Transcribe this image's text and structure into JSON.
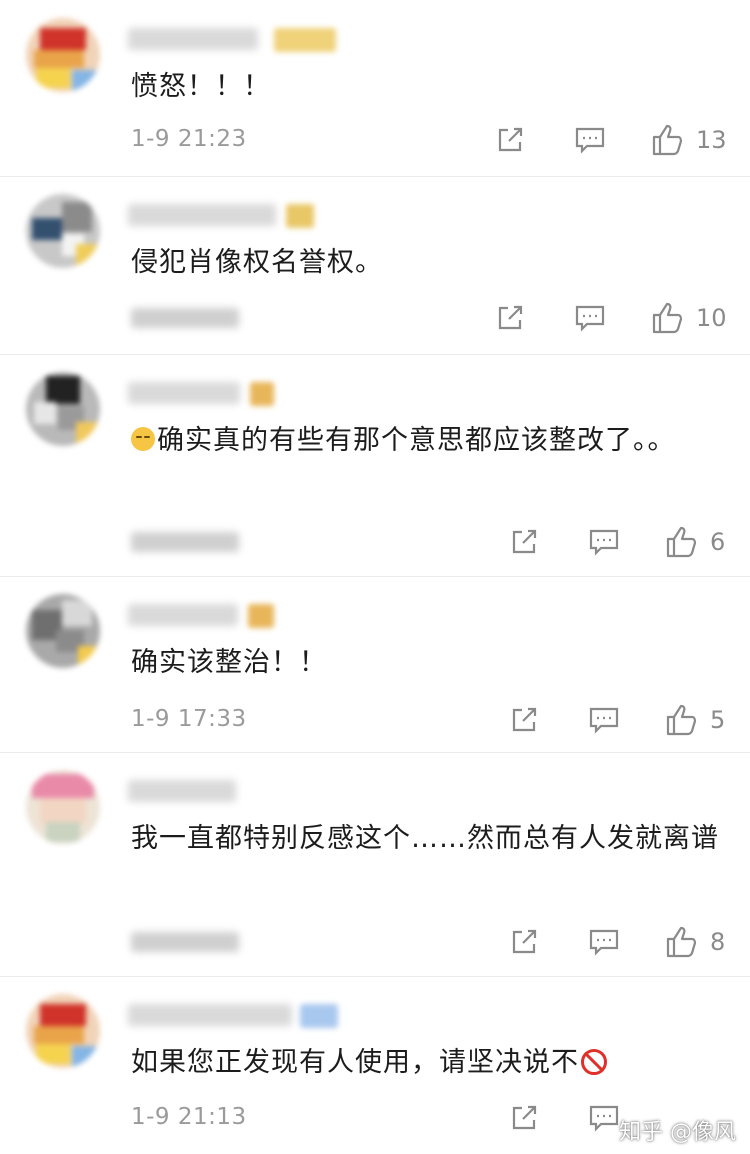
{
  "comments": [
    {
      "text": "愤怒！！！",
      "time": "1-9 21:23",
      "likes": "13",
      "time_blurred": false
    },
    {
      "text": "侵犯肖像权名誉权。",
      "time": "",
      "likes": "10",
      "time_blurred": true
    },
    {
      "text": "确实真的有些有那个意思都应该整改了。。",
      "time": "",
      "likes": "6",
      "time_blurred": true,
      "emoji": "pensive-emoji"
    },
    {
      "text": "确实该整治！！",
      "time": "1-9 17:33",
      "likes": "5",
      "time_blurred": false
    },
    {
      "text": "我一直都特别反感这个……然而总有人发就离谱",
      "time": "",
      "likes": "8",
      "time_blurred": true
    },
    {
      "text": "如果您正发现有人使用，请坚决说不",
      "time": "1-9 21:13",
      "likes": "",
      "time_blurred": false,
      "emoji": "prohibited-emoji"
    }
  ],
  "icons": {
    "repost": "share-edit-icon",
    "comment": "comment-icon",
    "like": "thumbs-up-icon"
  },
  "watermark": "知乎 @像风",
  "colors": {
    "text": "#1c1c1c",
    "meta": "#9a9a9a",
    "icon": "#8a8a8a",
    "divider": "#ececec"
  }
}
